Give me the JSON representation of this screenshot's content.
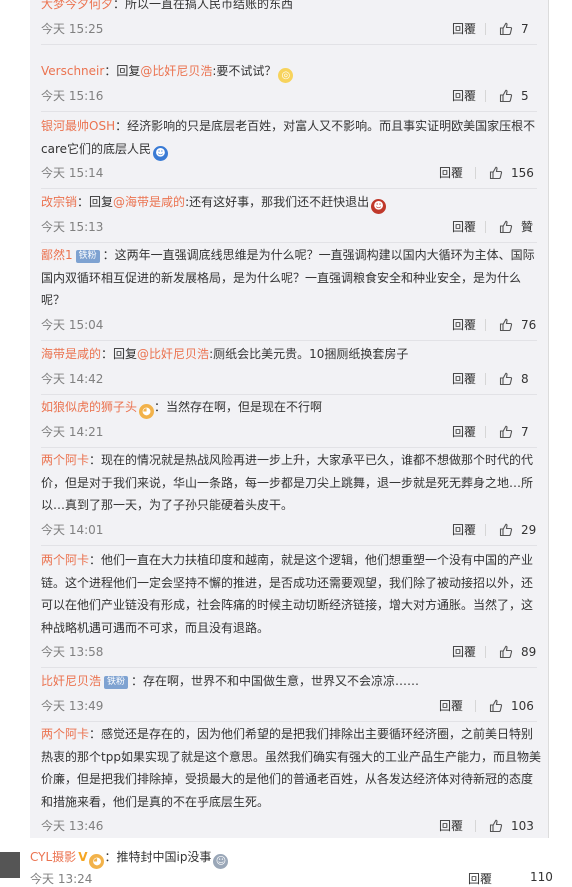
{
  "comments": [
    {
      "user": "大梦今夕何夕",
      "badge": "",
      "reply_to": "",
      "text": "：所以一直在搞人民币结账的东西",
      "time": "今天 15:25",
      "reply_label": "回覆",
      "likes": "7"
    },
    {
      "user": "Verschneir",
      "badge": "",
      "reply_to": "@比奸尼贝浩",
      "text": ":要不试试？",
      "time": "今天 15:16",
      "reply_label": "回覆",
      "likes": "5"
    },
    {
      "user": "银河最帅OSH",
      "badge": "",
      "reply_to": "",
      "text": "：经济影响的只是底层老百姓，对富人又不影响。而且事实证明欧美国家压根不care它们的底层人民",
      "time": "今天 15:14",
      "reply_label": "回覆",
      "likes": "156"
    },
    {
      "user": "改宗销",
      "badge": "",
      "reply_to": "@海带是咸的",
      "text": ":还有这好事，那我们还不赶快退出",
      "time": "今天 15:13",
      "reply_label": "回覆",
      "likes": "贊"
    },
    {
      "user": "鄙然1",
      "badge": "铁粉",
      "reply_to": "",
      "text": "：这两年一直强调底线思维是为什么呢？一直强调构建以国内大循环为主体、国际国内双循环相互促进的新发展格局，是为什么呢？一直强调粮食安全和种业安全，是为什么呢？",
      "time": "今天 15:04",
      "reply_label": "回覆",
      "likes": "76"
    },
    {
      "user": "海带是咸的",
      "badge": "",
      "reply_to": "@比奸尼贝浩",
      "text": ":厕纸会比美元贵。10捆厕纸换套房子",
      "time": "今天 14:42",
      "reply_label": "回覆",
      "likes": "8"
    },
    {
      "user": "如狼似虎的狮子头",
      "badge": "",
      "reply_to": "",
      "text": "：当然存在啊，但是现在不行啊",
      "time": "今天 14:21",
      "reply_label": "回覆",
      "likes": "7"
    },
    {
      "user": "两个阿卡",
      "badge": "",
      "reply_to": "",
      "text": "：现在的情况就是热战风险再进一步上升，大家承平已久，谁都不想做那个时代的代价，但是对于我们来说，华山一条路，每一步都是刀尖上跳舞，退一步就是死无葬身之地…所以…真到了那一天，为了子孙只能硬着头皮干。",
      "time": "今天 14:01",
      "reply_label": "回覆",
      "likes": "29"
    },
    {
      "user": "两个阿卡",
      "badge": "",
      "reply_to": "",
      "text": "：他们一直在大力扶植印度和越南，就是这个逻辑，他们想重塑一个没有中国的产业链。这个进程他们一定会坚持不懈的推进，是否成功还需要观望，我们除了被动接招以外，还可以在他们产业链没有形成，社会阵痛的时候主动切断经济链接，增大对方通胀。当然了，这种战略机遇可遇而不可求，而且没有退路。",
      "time": "今天 13:58",
      "reply_label": "回覆",
      "likes": "89"
    },
    {
      "user": "比奸尼贝浩",
      "badge": "铁粉",
      "reply_to": "",
      "text": "：存在啊，世界不和中国做生意，世界又不会凉凉……",
      "time": "今天 13:49",
      "reply_label": "回覆",
      "likes": "106"
    },
    {
      "user": "两个阿卡",
      "badge": "",
      "reply_to": "",
      "text": "：感觉还是存在的，因为他们希望的是把我们排除出主要循环经济圈，之前美日特别热衷的那个tpp如果实现了就是这个意思。虽然我们确实有强大的工业产品生产能力，而且物美价廉，但是把我们排除掉，受损最大的是他们的普通老百姓，从各发达经济体对待新冠的态度和措施来看，他们是真的不在乎底层生死。",
      "time": "今天 13:46",
      "reply_label": "回覆",
      "likes": "103"
    }
  ],
  "bottom": {
    "user": "CYL摄影",
    "text": "：推特封中国ip没事",
    "time": "今天 13:24",
    "reply_label": "回覆",
    "likes": "110"
  },
  "reply_prefix": "回复",
  "colors": {
    "username": "#eb7350",
    "meta": "#808080",
    "background": "#f2f2f5",
    "badge": "#7ea2d1"
  }
}
